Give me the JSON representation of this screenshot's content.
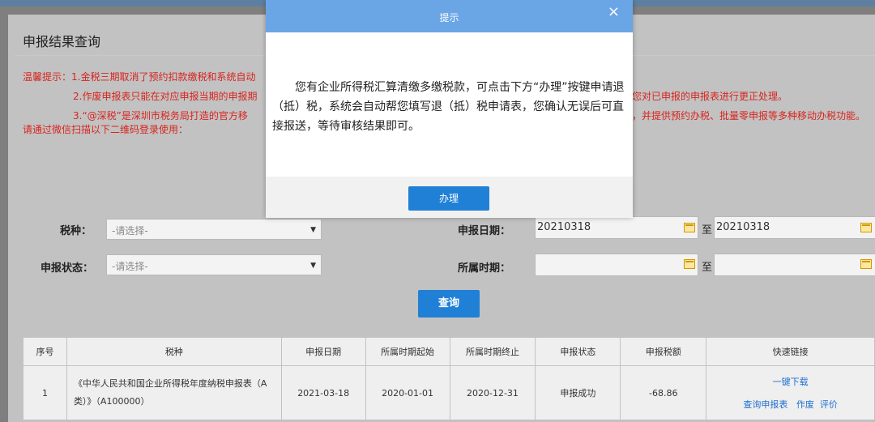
{
  "page": {
    "title": "申报结果查询",
    "tips": [
      "温馨提示：1.金税三期取消了预约扣款缴税和系统自动",
      "2.作废申报表只能在对应申报当期的申报期",
      "您对已申报的申报表进行更正处理。",
      "3.“@深税”是深圳市税务局打造的官方移",
      "，并提供预约办税、批量零申报等多种移动办税功能。",
      "请通过微信扫描以下二维码登录使用："
    ]
  },
  "form": {
    "tax_type_label": "税种：",
    "tax_type_value": "-请选择-",
    "status_label": "申报状态：",
    "status_value": "-请选择-",
    "date_label": "申报日期：",
    "date_from": "20210318",
    "date_to": "20210318",
    "period_label": "所属时期：",
    "period_from": "",
    "period_to": "",
    "to_text": "至",
    "query_button": "查询"
  },
  "table": {
    "headers": [
      "序号",
      "税种",
      "申报日期",
      "所属时期起始",
      "所属时期终止",
      "申报状态",
      "申报税额",
      "快速链接"
    ],
    "rows": [
      {
        "index": "1",
        "tax_name": "《中华人民共和国企业所得税年度纳税申报表（A类）》（A100000）",
        "date": "2021-03-18",
        "period_start": "2020-01-01",
        "period_end": "2020-12-31",
        "status": "申报成功",
        "amount": "-68.86",
        "links": {
          "download": "一键下载",
          "view": "查询申报表",
          "void": "作废",
          "rate": "评价"
        }
      }
    ]
  },
  "modal": {
    "title": "提示",
    "close": "×",
    "message": "您有企业所得税汇算清缴多缴税款，可点击下方“办理”按键申请退（抵）税，系统会自动帮您填写退（抵）税申请表，您确认无误后可直接报送，等待审核结果即可。",
    "button": "办理"
  },
  "colors": {
    "primary": "#1f80d6",
    "modal_header": "#6aa6e6",
    "tip_red": "#d8241e",
    "link": "#1f6fd1"
  }
}
